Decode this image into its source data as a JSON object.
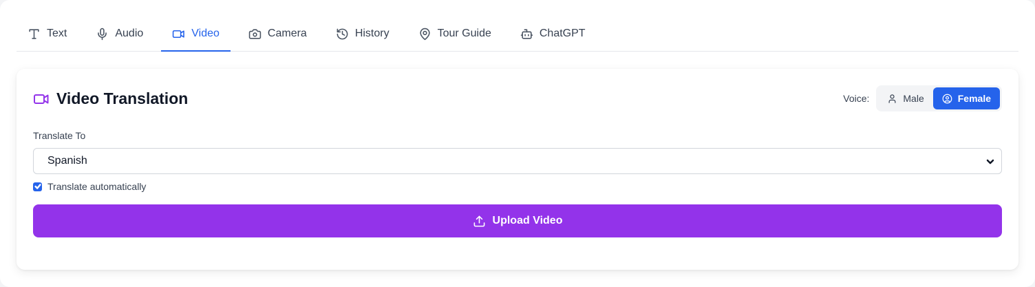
{
  "tabs": [
    {
      "label": "Text",
      "icon": "type-icon",
      "active": false
    },
    {
      "label": "Audio",
      "icon": "mic-icon",
      "active": false
    },
    {
      "label": "Video",
      "icon": "video-icon",
      "active": true
    },
    {
      "label": "Camera",
      "icon": "camera-icon",
      "active": false
    },
    {
      "label": "History",
      "icon": "history-icon",
      "active": false
    },
    {
      "label": "Tour Guide",
      "icon": "map-pin-icon",
      "active": false
    },
    {
      "label": "ChatGPT",
      "icon": "bot-icon",
      "active": false
    }
  ],
  "card": {
    "title": "Video Translation",
    "title_icon": "video-icon",
    "voice": {
      "label": "Voice:",
      "options": [
        "Male",
        "Female"
      ],
      "selected": "Female"
    },
    "translate_to": {
      "label": "Translate To",
      "value": "Spanish"
    },
    "auto_translate": {
      "label": "Translate automatically",
      "checked": true
    },
    "upload_button": "Upload Video"
  },
  "colors": {
    "accent_blue": "#2563eb",
    "accent_purple": "#9333ea",
    "background": "#f3f4f6"
  }
}
